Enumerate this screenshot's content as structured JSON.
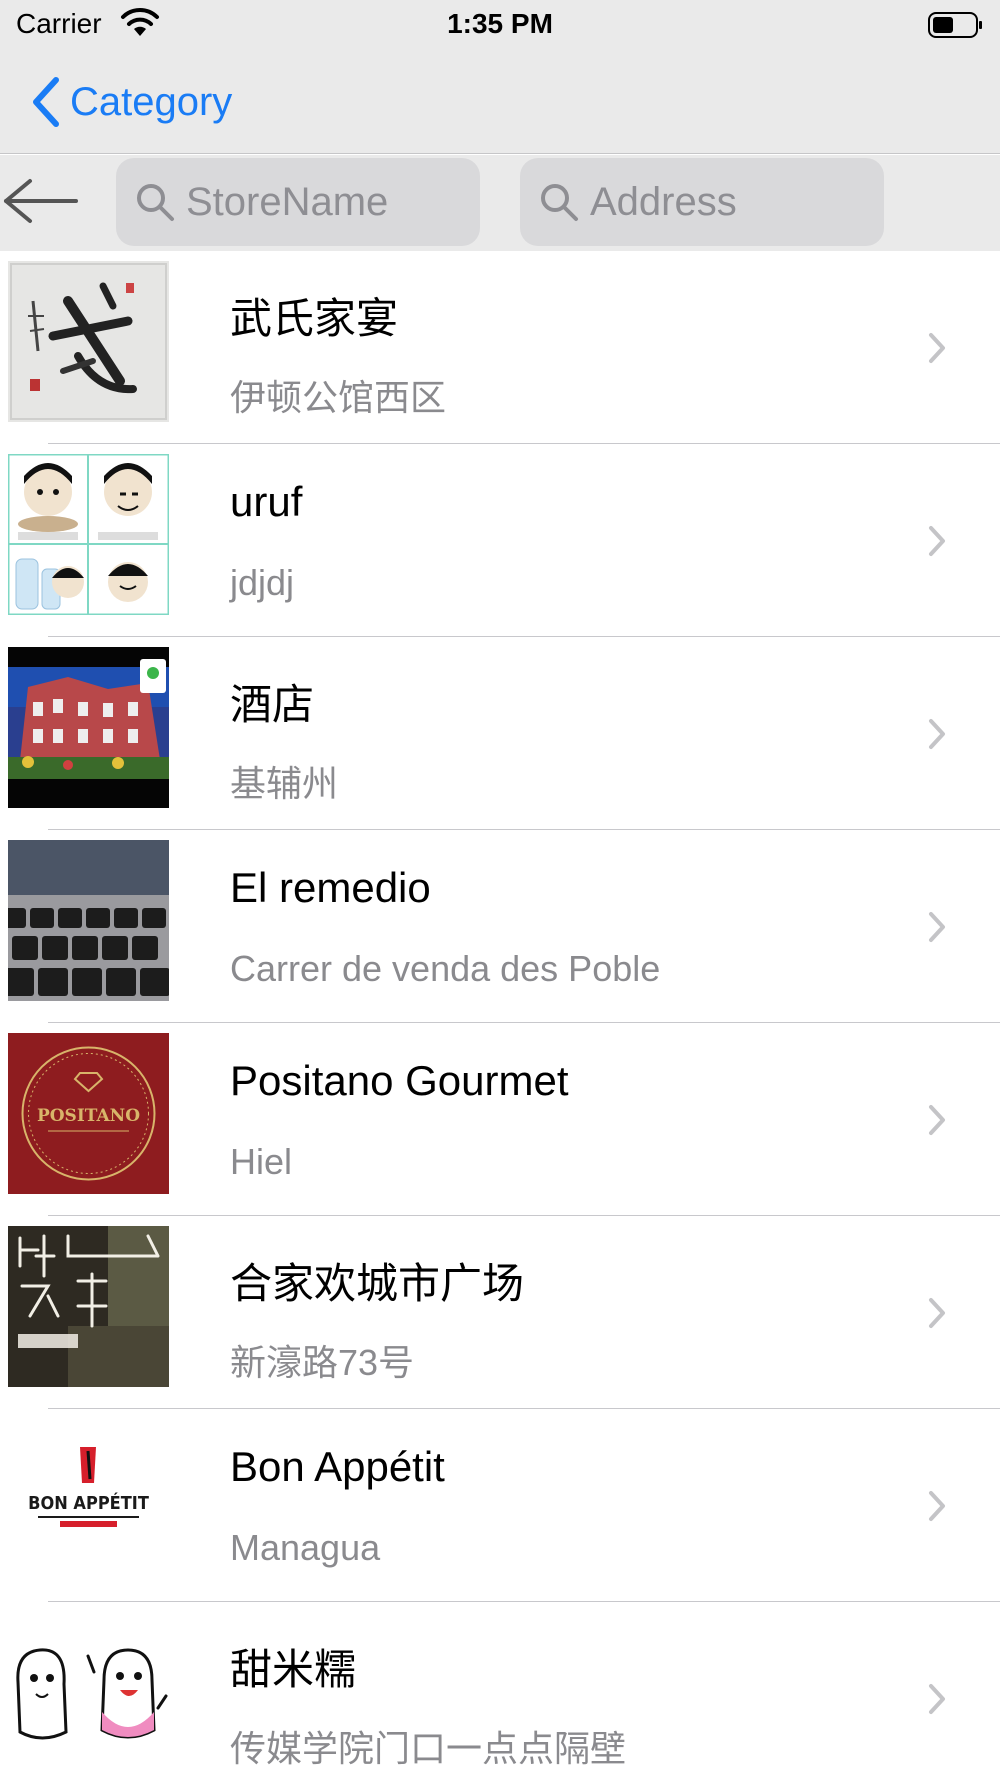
{
  "status_bar": {
    "carrier": "Carrier",
    "time": "1:35 PM"
  },
  "nav": {
    "back_label": "Category"
  },
  "search": {
    "store_placeholder": "StoreName",
    "address_placeholder": "Address"
  },
  "stores": [
    {
      "name": "武氏家宴",
      "address": "伊顿公馆西区",
      "thumb": "calligraphy"
    },
    {
      "name": "uruf",
      "address": "jdjdj",
      "thumb": "meme-grid"
    },
    {
      "name": "酒店",
      "address": "基辅州",
      "thumb": "building"
    },
    {
      "name": "El remedio",
      "address": "Carrer de venda des Poble",
      "thumb": "keyboard"
    },
    {
      "name": "Positano Gourmet",
      "address": "Hiel",
      "thumb": "positano-logo"
    },
    {
      "name": "合家欢城市广场",
      "address": "新濠路73号",
      "thumb": "neon-sign"
    },
    {
      "name": "Bon Appétit",
      "address": "Managua",
      "thumb": "bon-appetit-logo"
    },
    {
      "name": "甜米糯",
      "address": "传媒学院门口一点点隔壁",
      "thumb": "cartoon-mascots"
    }
  ],
  "thumb_text": {
    "positano": "POSITANO",
    "bon_appetit": "BON APPÉTIT"
  },
  "colors": {
    "accent": "#1a7cf5",
    "bar_background": "#eaeaea",
    "secondary_text": "#8a8a8e"
  }
}
